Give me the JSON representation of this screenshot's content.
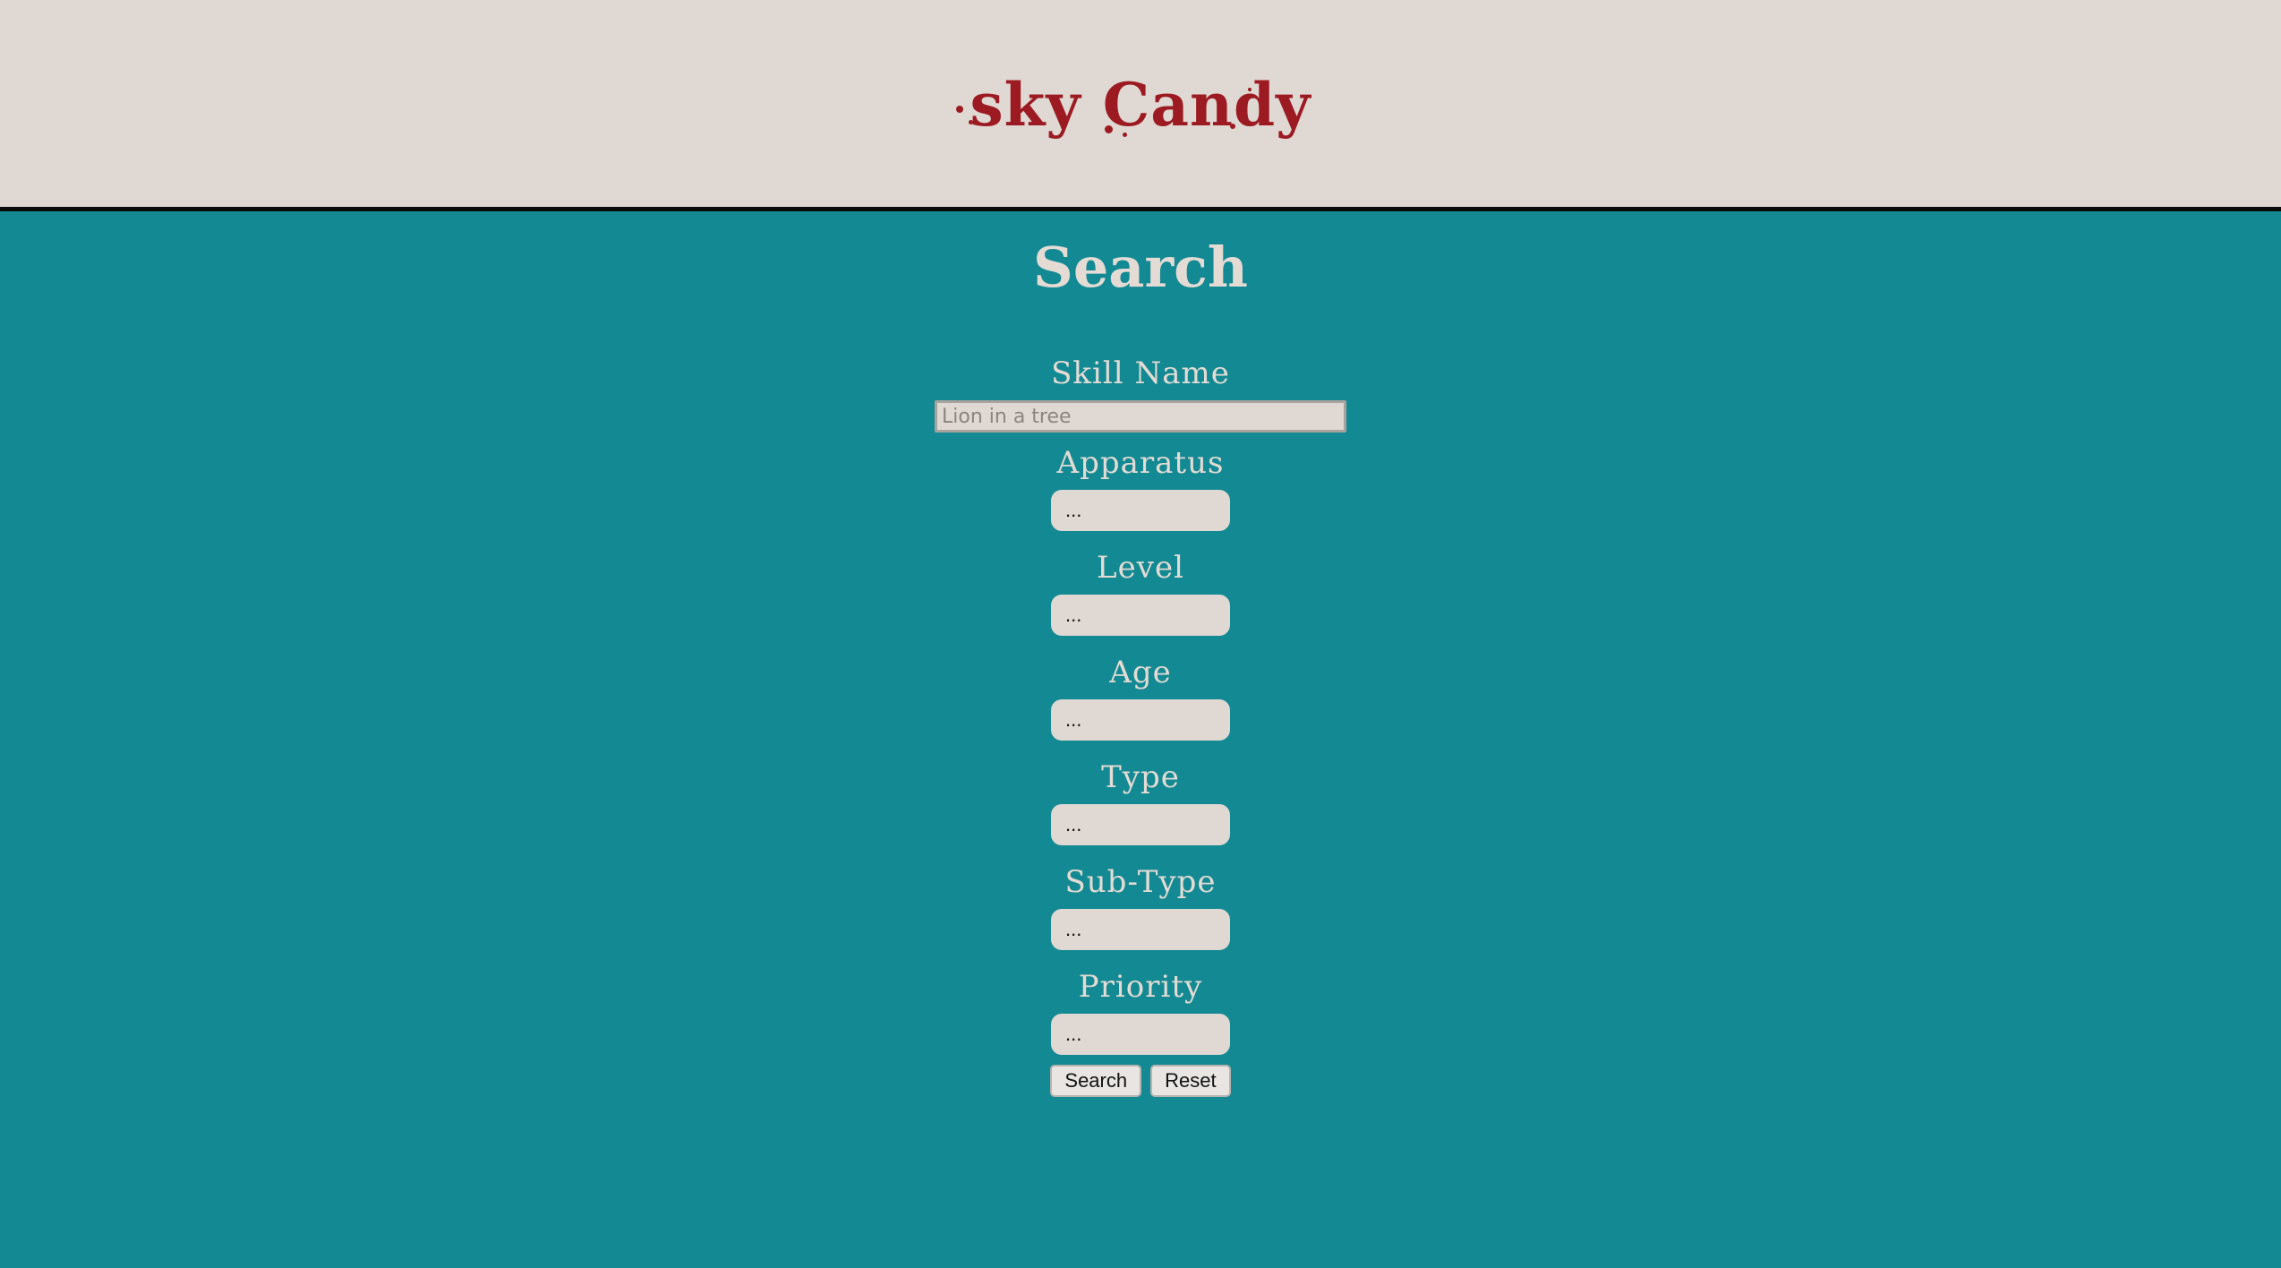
{
  "header": {
    "logo_text": "sky Candy"
  },
  "page": {
    "title": "Search"
  },
  "form": {
    "skill_name": {
      "label": "Skill Name",
      "placeholder": "Lion in a tree",
      "value": ""
    },
    "apparatus": {
      "label": "Apparatus",
      "value": "..."
    },
    "level": {
      "label": "Level",
      "value": "..."
    },
    "age": {
      "label": "Age",
      "value": "..."
    },
    "type": {
      "label": "Type",
      "value": "..."
    },
    "sub_type": {
      "label": "Sub-Type",
      "value": "..."
    },
    "priority": {
      "label": "Priority",
      "value": "..."
    }
  },
  "actions": {
    "search_label": "Search",
    "reset_label": "Reset"
  },
  "colors": {
    "header_bg": "#e0d8d2",
    "main_bg": "#138a93",
    "logo": "#9c1a22",
    "text_light": "#e3dbd4"
  }
}
